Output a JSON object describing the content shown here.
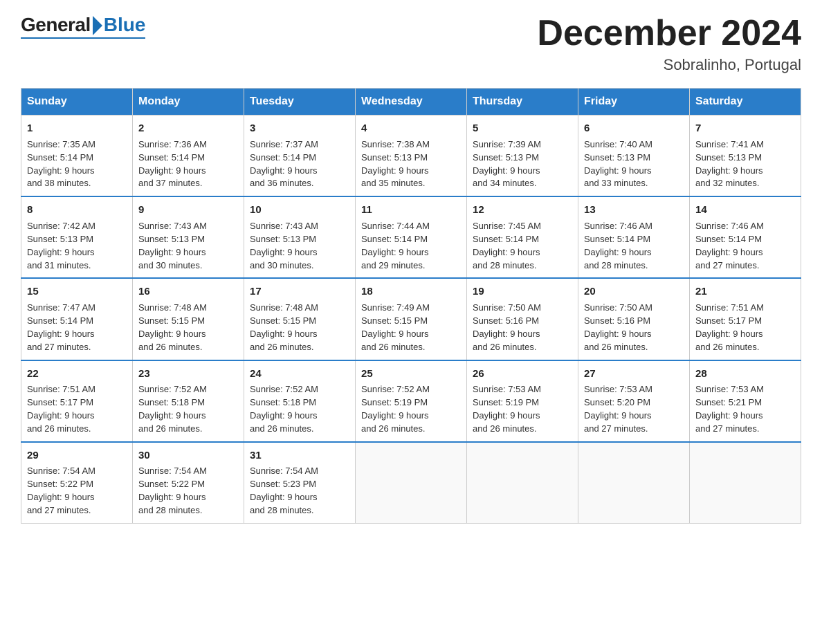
{
  "header": {
    "logo_general": "General",
    "logo_blue": "Blue",
    "title": "December 2024",
    "subtitle": "Sobralinho, Portugal"
  },
  "days_of_week": [
    "Sunday",
    "Monday",
    "Tuesday",
    "Wednesday",
    "Thursday",
    "Friday",
    "Saturday"
  ],
  "weeks": [
    [
      {
        "day": "1",
        "sunrise": "7:35 AM",
        "sunset": "5:14 PM",
        "daylight": "9 hours and 38 minutes."
      },
      {
        "day": "2",
        "sunrise": "7:36 AM",
        "sunset": "5:14 PM",
        "daylight": "9 hours and 37 minutes."
      },
      {
        "day": "3",
        "sunrise": "7:37 AM",
        "sunset": "5:14 PM",
        "daylight": "9 hours and 36 minutes."
      },
      {
        "day": "4",
        "sunrise": "7:38 AM",
        "sunset": "5:13 PM",
        "daylight": "9 hours and 35 minutes."
      },
      {
        "day": "5",
        "sunrise": "7:39 AM",
        "sunset": "5:13 PM",
        "daylight": "9 hours and 34 minutes."
      },
      {
        "day": "6",
        "sunrise": "7:40 AM",
        "sunset": "5:13 PM",
        "daylight": "9 hours and 33 minutes."
      },
      {
        "day": "7",
        "sunrise": "7:41 AM",
        "sunset": "5:13 PM",
        "daylight": "9 hours and 32 minutes."
      }
    ],
    [
      {
        "day": "8",
        "sunrise": "7:42 AM",
        "sunset": "5:13 PM",
        "daylight": "9 hours and 31 minutes."
      },
      {
        "day": "9",
        "sunrise": "7:43 AM",
        "sunset": "5:13 PM",
        "daylight": "9 hours and 30 minutes."
      },
      {
        "day": "10",
        "sunrise": "7:43 AM",
        "sunset": "5:13 PM",
        "daylight": "9 hours and 30 minutes."
      },
      {
        "day": "11",
        "sunrise": "7:44 AM",
        "sunset": "5:14 PM",
        "daylight": "9 hours and 29 minutes."
      },
      {
        "day": "12",
        "sunrise": "7:45 AM",
        "sunset": "5:14 PM",
        "daylight": "9 hours and 28 minutes."
      },
      {
        "day": "13",
        "sunrise": "7:46 AM",
        "sunset": "5:14 PM",
        "daylight": "9 hours and 28 minutes."
      },
      {
        "day": "14",
        "sunrise": "7:46 AM",
        "sunset": "5:14 PM",
        "daylight": "9 hours and 27 minutes."
      }
    ],
    [
      {
        "day": "15",
        "sunrise": "7:47 AM",
        "sunset": "5:14 PM",
        "daylight": "9 hours and 27 minutes."
      },
      {
        "day": "16",
        "sunrise": "7:48 AM",
        "sunset": "5:15 PM",
        "daylight": "9 hours and 26 minutes."
      },
      {
        "day": "17",
        "sunrise": "7:48 AM",
        "sunset": "5:15 PM",
        "daylight": "9 hours and 26 minutes."
      },
      {
        "day": "18",
        "sunrise": "7:49 AM",
        "sunset": "5:15 PM",
        "daylight": "9 hours and 26 minutes."
      },
      {
        "day": "19",
        "sunrise": "7:50 AM",
        "sunset": "5:16 PM",
        "daylight": "9 hours and 26 minutes."
      },
      {
        "day": "20",
        "sunrise": "7:50 AM",
        "sunset": "5:16 PM",
        "daylight": "9 hours and 26 minutes."
      },
      {
        "day": "21",
        "sunrise": "7:51 AM",
        "sunset": "5:17 PM",
        "daylight": "9 hours and 26 minutes."
      }
    ],
    [
      {
        "day": "22",
        "sunrise": "7:51 AM",
        "sunset": "5:17 PM",
        "daylight": "9 hours and 26 minutes."
      },
      {
        "day": "23",
        "sunrise": "7:52 AM",
        "sunset": "5:18 PM",
        "daylight": "9 hours and 26 minutes."
      },
      {
        "day": "24",
        "sunrise": "7:52 AM",
        "sunset": "5:18 PM",
        "daylight": "9 hours and 26 minutes."
      },
      {
        "day": "25",
        "sunrise": "7:52 AM",
        "sunset": "5:19 PM",
        "daylight": "9 hours and 26 minutes."
      },
      {
        "day": "26",
        "sunrise": "7:53 AM",
        "sunset": "5:19 PM",
        "daylight": "9 hours and 26 minutes."
      },
      {
        "day": "27",
        "sunrise": "7:53 AM",
        "sunset": "5:20 PM",
        "daylight": "9 hours and 27 minutes."
      },
      {
        "day": "28",
        "sunrise": "7:53 AM",
        "sunset": "5:21 PM",
        "daylight": "9 hours and 27 minutes."
      }
    ],
    [
      {
        "day": "29",
        "sunrise": "7:54 AM",
        "sunset": "5:22 PM",
        "daylight": "9 hours and 27 minutes."
      },
      {
        "day": "30",
        "sunrise": "7:54 AM",
        "sunset": "5:22 PM",
        "daylight": "9 hours and 28 minutes."
      },
      {
        "day": "31",
        "sunrise": "7:54 AM",
        "sunset": "5:23 PM",
        "daylight": "9 hours and 28 minutes."
      },
      null,
      null,
      null,
      null
    ]
  ],
  "labels": {
    "sunrise": "Sunrise:",
    "sunset": "Sunset:",
    "daylight": "Daylight:"
  }
}
